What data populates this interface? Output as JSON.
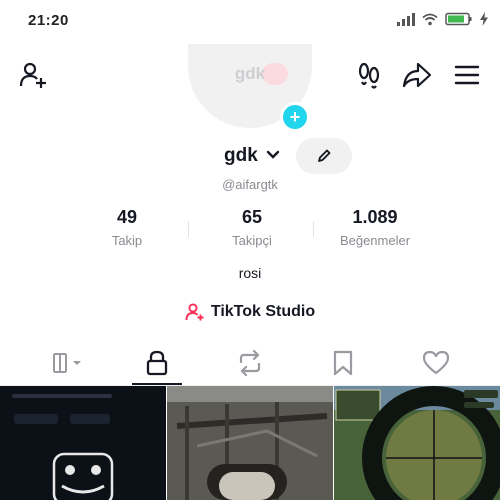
{
  "status_bar": {
    "time": "21:20"
  },
  "top_bar": {
    "icons": [
      "add-friend-icon",
      "footprints-icon",
      "share-icon",
      "menu-icon"
    ]
  },
  "profile": {
    "avatar_name": "gdk",
    "display_name": "gdk",
    "handle": "@aifargtk",
    "bio": "rosi",
    "accent_color": "#fe2c55",
    "badge_color": "#20d5ec"
  },
  "stats": [
    {
      "value": "49",
      "label": "Takip"
    },
    {
      "value": "65",
      "label": "Takipçi"
    },
    {
      "value": "1.089",
      "label": "Beğenmeler"
    }
  ],
  "studio": {
    "label": "TikTok Studio"
  },
  "tabs": {
    "items": [
      "videos-grid-icon",
      "lock-icon",
      "repost-icon",
      "bookmark-icon",
      "heart-icon"
    ],
    "selected_index": 1
  }
}
